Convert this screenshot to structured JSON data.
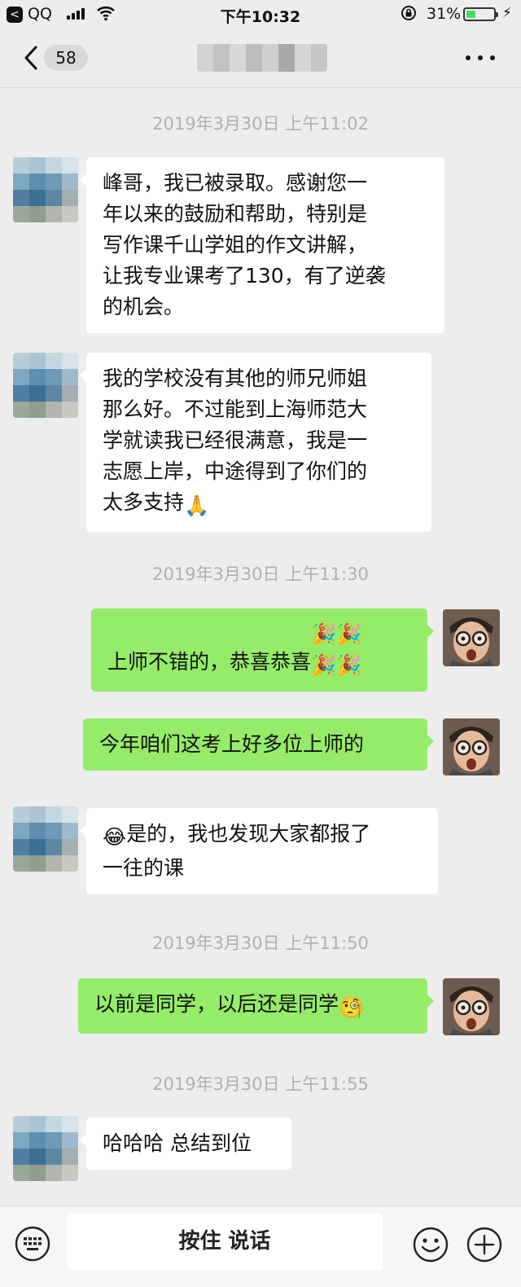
{
  "status_bar": {
    "back_app_glyph": "<",
    "app_name": "QQ",
    "time": "下午10:32",
    "battery_percent": "31%",
    "battery_level": 0.31
  },
  "nav": {
    "unread_count": "58",
    "title_blurred": true
  },
  "messages": [
    {
      "type": "timestamp",
      "text": "2019年3月30日 上午11:02"
    },
    {
      "type": "incoming",
      "lines": [
        "峰哥，我已被录取。感谢您一",
        "年以来的鼓励和帮助，特别是",
        "写作课千山学姐的作文讲解，",
        "让我专业课考了130，有了逆袭",
        "的机会。"
      ]
    },
    {
      "type": "incoming",
      "lines": [
        "我的学校没有其他的师兄师姐",
        "那么好。不过能到上海师范大",
        "学就读我已经很满意，我是一",
        "志愿上岸，中途得到了你们的",
        "太多支持"
      ],
      "emoji": "🙏"
    },
    {
      "type": "timestamp",
      "text": "2019年3月30日 上午11:30"
    },
    {
      "type": "outgoing",
      "lines": [
        "上师不错的，恭喜恭喜"
      ],
      "emoji": "🎉🎉🎉🎉"
    },
    {
      "type": "outgoing",
      "lines": [
        "今年咱们这考上好多位上师的"
      ]
    },
    {
      "type": "incoming",
      "lines": [
        "是的，我也发现大家都报了",
        "一往的课"
      ],
      "emoji": "😂"
    },
    {
      "type": "timestamp",
      "text": "2019年3月30日 上午11:50"
    },
    {
      "type": "outgoing",
      "lines": [
        "以前是同学，以后还是同学"
      ],
      "emoji": "🧐"
    },
    {
      "type": "timestamp",
      "text": "2019年3月30日 上午11:55"
    },
    {
      "type": "incoming",
      "lines": [
        "哈哈哈 总结到位"
      ]
    }
  ],
  "input_bar": {
    "hold_to_talk": "按住 说话"
  },
  "colors": {
    "background": "#ededed",
    "incoming_bubble": "#ffffff",
    "outgoing_bubble": "#95ec69",
    "timestamp_text": "#b0b0b0"
  }
}
